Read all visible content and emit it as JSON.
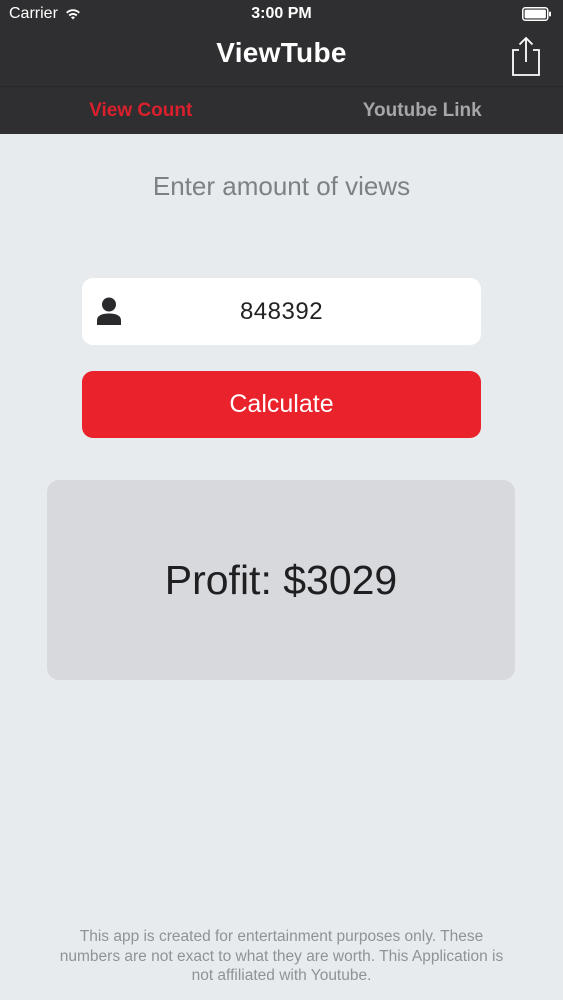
{
  "status_bar": {
    "carrier": "Carrier",
    "time": "3:00 PM",
    "wifi_icon": "wifi-icon",
    "battery_icon": "battery-full-icon"
  },
  "nav": {
    "title": "ViewTube",
    "share_icon": "share-icon"
  },
  "tabs": [
    {
      "label": "View Count",
      "active": true
    },
    {
      "label": "Youtube Link",
      "active": false
    }
  ],
  "main": {
    "prompt": "Enter amount of views",
    "views_field": {
      "value": "848392",
      "icon": "user-icon"
    },
    "calculate_label": "Calculate",
    "result": "Profit: $3029"
  },
  "footer": {
    "disclaimer": "This app is created for entertainment purposes only. These numbers are not exact to what they are worth. This Application is not affiliated with Youtube."
  },
  "colors": {
    "nav_background": "#2f2f31",
    "accent_red": "#e9222b",
    "active_tab": "#d9202c",
    "inactive_tab": "#a6a6aa",
    "page_background": "#e8ebee",
    "result_panel": "#d8d9dd"
  }
}
